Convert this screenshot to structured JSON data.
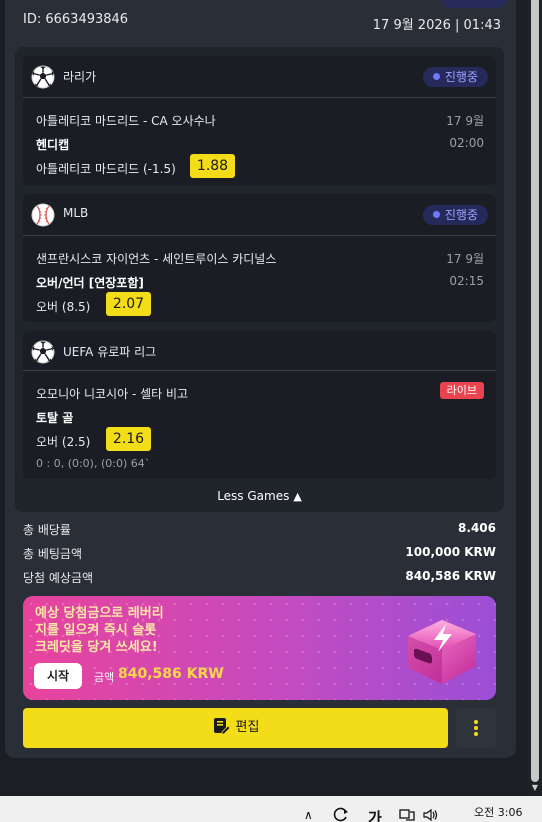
{
  "header": {
    "bet_id": "ID: 6663493846",
    "datetime": "17 9월 2026 | 01:43"
  },
  "games": [
    {
      "league": "라리가",
      "sport_icon": "soccer-ball-icon",
      "status": "진행중",
      "match": "아틀레티코 마드리드 - CA 오사수나",
      "date": "17 9월",
      "market": "헨디캡",
      "time": "02:00",
      "selection": "아틀레티코 마드리드 (-1.5)",
      "odds": "1.88"
    },
    {
      "league": "MLB",
      "sport_icon": "baseball-icon",
      "status": "진행중",
      "match": "샌프란시스코 자이언츠 - 세인트루이스 카디널스",
      "date": "17 9월",
      "market": "오버/언더 [연장포함]",
      "time": "02:15",
      "selection": "오버 (8.5)",
      "odds": "2.07"
    },
    {
      "league": "UEFA 유로파 리그",
      "sport_icon": "soccer-ball-icon",
      "live": "라이브",
      "match": "오모니아 니코시아 - 셀타 비고",
      "market": "토탈 골",
      "selection": "오버 (2.5)",
      "odds": "2.16",
      "score": "0 : 0, (0:0), (0:0) 64`"
    }
  ],
  "less_games": "Less Games",
  "summary": [
    {
      "label": "총 배당률",
      "value": "8.406"
    },
    {
      "label": "총 베팅금액",
      "value": "100,000 KRW"
    },
    {
      "label": "당첨 예상금액",
      "value": "840,586 KRW"
    }
  ],
  "promo": {
    "lines": [
      "예상 당첨금으로 레버리",
      "지를 일으켜 즉시 슬롯",
      "크레딧을 당겨 쓰세요!"
    ],
    "start": "시작",
    "amount_label": "금액",
    "amount": "840,586 KRW"
  },
  "actions": {
    "edit": "편집"
  },
  "taskbar": {
    "ime": "가",
    "clock": "오전 3:06"
  },
  "colors": {
    "accent_yellow": "#f3dc18",
    "status_purple": "#9aa2ff",
    "live_red": "#e9434f",
    "background": "#1b1e24"
  }
}
